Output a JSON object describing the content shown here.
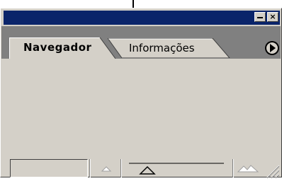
{
  "window": {
    "title": "",
    "minimize_glyph": "",
    "close_glyph": "×"
  },
  "tabs": [
    {
      "label": "Navegador",
      "active": true
    },
    {
      "label": "Informações",
      "active": false
    }
  ],
  "menu_button": {
    "icon": "play-right-icon"
  },
  "navigator": {
    "zoom_value": "",
    "zoom_out_icon": "small-mountain-icon",
    "zoom_in_icon": "large-mountain-icon"
  },
  "colors": {
    "titlebar": "#0a246a",
    "face": "#d4d0c8",
    "tabstrip": "#808080"
  }
}
